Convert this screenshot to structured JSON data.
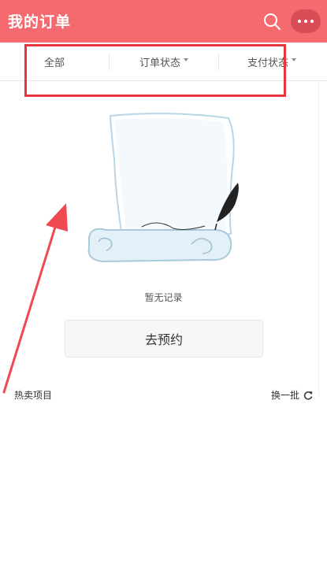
{
  "header": {
    "title": "我的订单",
    "search_icon": "search-icon",
    "more_icon": "more-dots-icon"
  },
  "filters": {
    "all": "全部",
    "order_status": "订单状态",
    "payment_status": "支付状态"
  },
  "empty": {
    "message": "暂无记录",
    "button": "去预约"
  },
  "hot": {
    "label": "热卖项目",
    "refresh": "换一批"
  },
  "colors": {
    "header_bg": "#f46a6f",
    "more_bg": "#d84d56",
    "annotation_red": "#e8343f"
  }
}
